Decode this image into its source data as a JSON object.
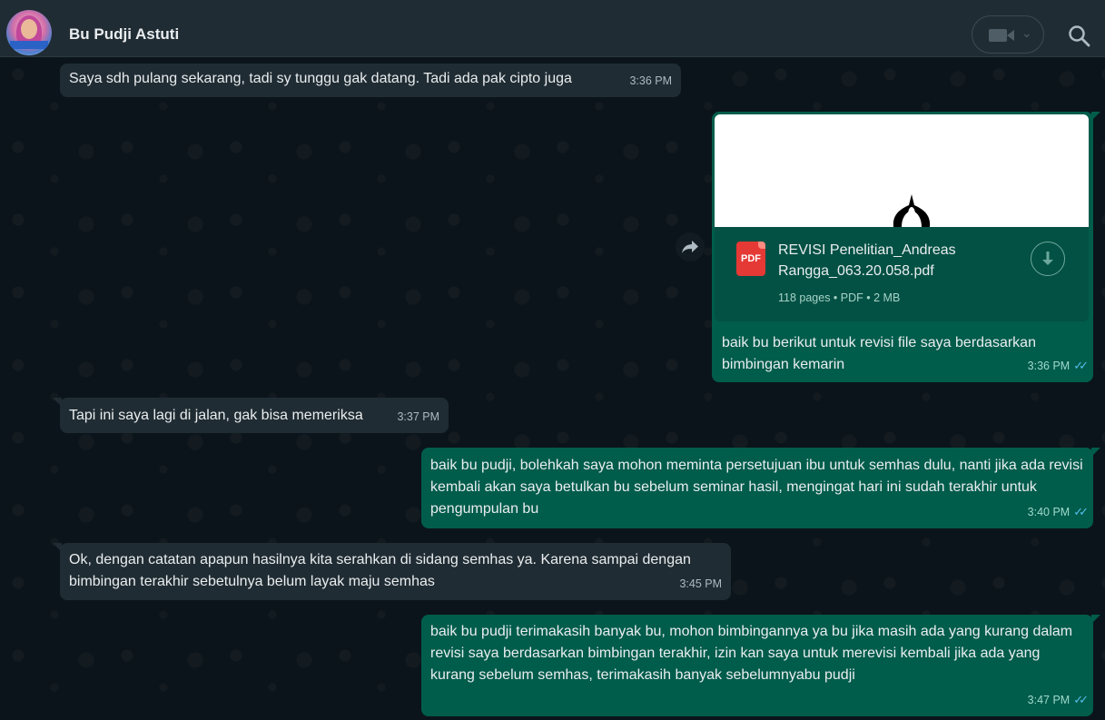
{
  "header": {
    "contact_name": "Bu Pudji Astuti"
  },
  "icons": {
    "video": "video-camera-icon",
    "chevron": "chevron-down-icon",
    "search": "search-icon",
    "download": "download-icon",
    "forward": "forward-icon",
    "pdf": "pdf-file-icon"
  },
  "colors": {
    "incoming_bubble": "#202c33",
    "outgoing_bubble": "#005c4b",
    "read_ticks": "#53bdeb",
    "background": "#0b141a"
  },
  "messages": [
    {
      "direction": "in",
      "text": "Saya sdh pulang sekarang, tadi sy tunggu gak datang. Tadi ada pak cipto juga",
      "time": "3:36 PM"
    },
    {
      "direction": "out",
      "attachment": {
        "badge": "PDF",
        "file_name": "REVISI Penelitian_Andreas Rangga_063.20.058.pdf",
        "meta": "118 pages • PDF • 2 MB"
      },
      "text": "baik bu berikut untuk revisi file saya berdasarkan bimbingan kemarin",
      "time": "3:36 PM",
      "ticks": "✓✓"
    },
    {
      "direction": "in",
      "text": "Tapi ini saya lagi di jalan, gak bisa memeriksa",
      "time": "3:37 PM"
    },
    {
      "direction": "out",
      "text": "baik bu pudji, bolehkah saya mohon meminta persetujuan ibu untuk semhas dulu, nanti jika ada revisi kembali akan saya betulkan bu sebelum seminar hasil, mengingat hari ini sudah terakhir untuk pengumpulan bu",
      "time": "3:40 PM",
      "ticks": "✓✓"
    },
    {
      "direction": "in",
      "text": "Ok, dengan catatan apapun hasilnya kita serahkan di sidang semhas ya. Karena sampai dengan bimbingan terakhir sebetulnya belum layak maju semhas",
      "time": "3:45 PM"
    },
    {
      "direction": "out",
      "text": "baik bu pudji terimakasih banyak bu, mohon bimbingannya ya bu jika masih ada yang kurang dalam revisi saya berdasarkan bimbingan terakhir, izin kan saya untuk merevisi kembali jika ada yang kurang sebelum semhas, terimakasih banyak sebelumnyabu pudji",
      "time": "3:47 PM",
      "ticks": "✓✓"
    }
  ]
}
